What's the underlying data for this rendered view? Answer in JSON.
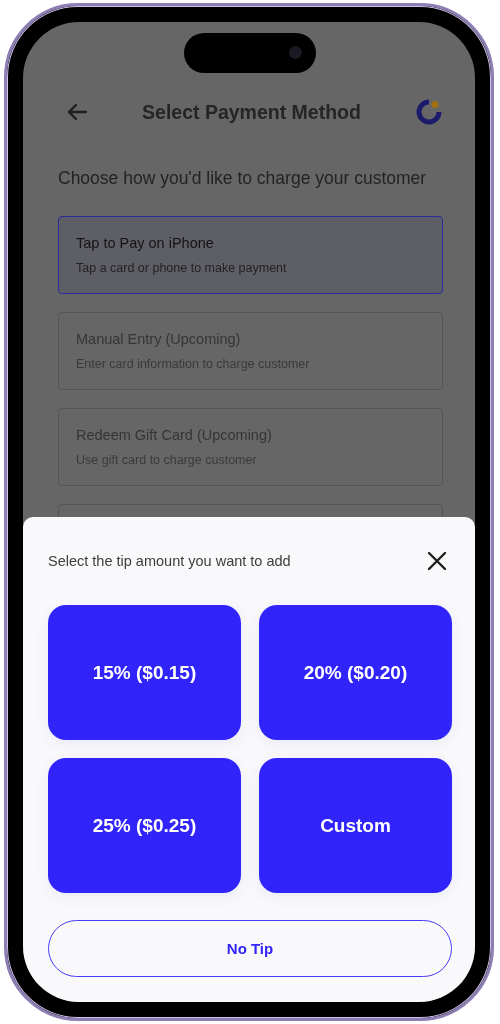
{
  "header": {
    "title": "Select Payment Method"
  },
  "prompt": "Choose how you'd like to charge your customer",
  "payment_methods": [
    {
      "title": "Tap to Pay on iPhone",
      "description": "Tap a card or phone to make payment",
      "selected": true,
      "disabled": false
    },
    {
      "title": "Manual Entry (Upcoming)",
      "description": "Enter card information to charge customer",
      "selected": false,
      "disabled": true
    },
    {
      "title": "Redeem Gift Card (Upcoming)",
      "description": "Use gift card to charge customer",
      "selected": false,
      "disabled": true
    }
  ],
  "tip_sheet": {
    "title": "Select the tip amount you want to add",
    "options": [
      {
        "label": "15% ($0.15)"
      },
      {
        "label": "20% ($0.20)"
      },
      {
        "label": "25% ($0.25)"
      },
      {
        "label": "Custom"
      }
    ],
    "no_tip_label": "No Tip"
  }
}
